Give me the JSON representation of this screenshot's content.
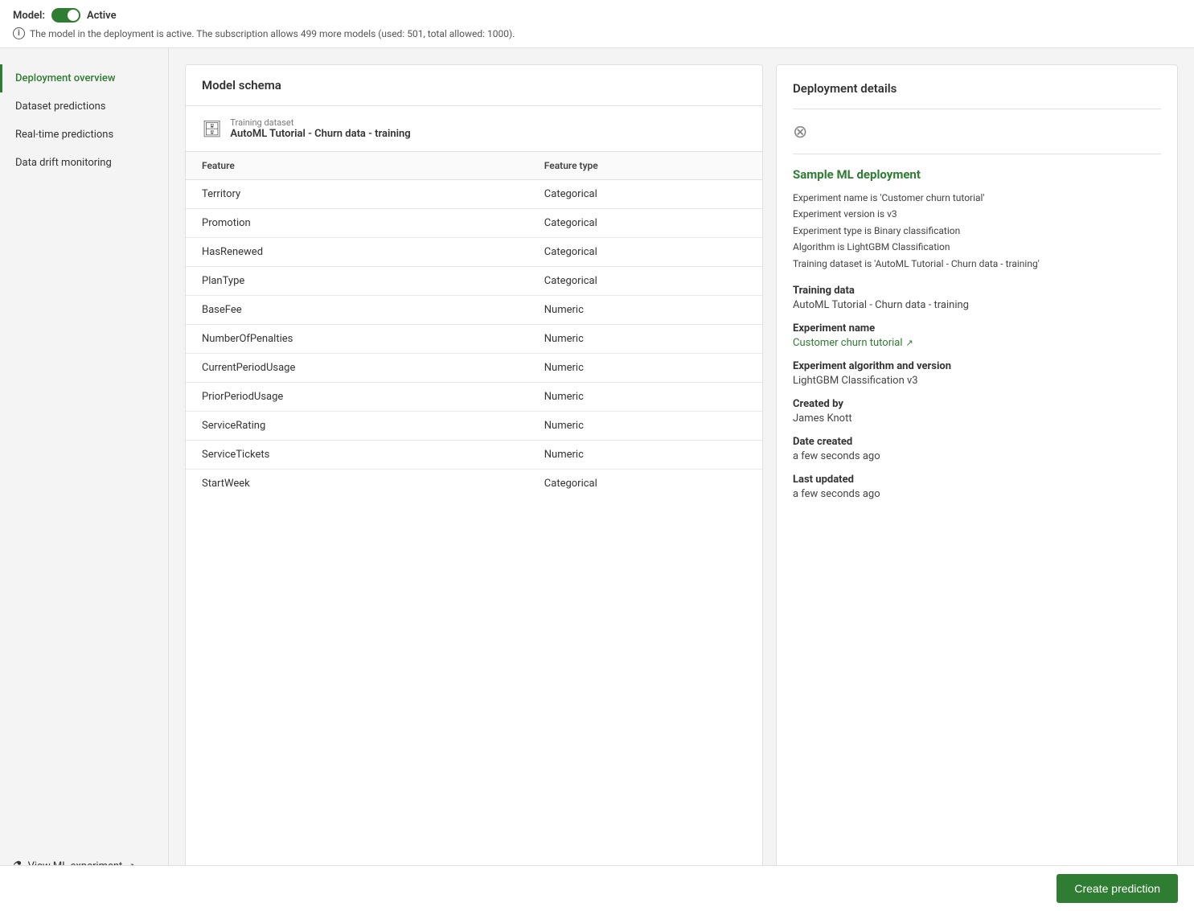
{
  "topBar": {
    "modelLabel": "Model:",
    "modelStatus": "Active",
    "infoMessage": "The model in the deployment is active. The subscription allows 499 more models (used: 501, total allowed: 1000)."
  },
  "sidebar": {
    "navItems": [
      {
        "id": "deployment-overview",
        "label": "Deployment overview",
        "active": true
      },
      {
        "id": "dataset-predictions",
        "label": "Dataset predictions",
        "active": false
      },
      {
        "id": "realtime-predictions",
        "label": "Real-time predictions",
        "active": false
      },
      {
        "id": "data-drift-monitoring",
        "label": "Data drift monitoring",
        "active": false
      }
    ],
    "viewExperiment": "View ML experiment"
  },
  "modelSchema": {
    "title": "Model schema",
    "trainingDatasetLabel": "Training dataset",
    "trainingDatasetName": "AutoML Tutorial - Churn data - training",
    "tableHeaders": [
      "Feature",
      "Feature type"
    ],
    "features": [
      {
        "name": "Territory",
        "type": "Categorical"
      },
      {
        "name": "Promotion",
        "type": "Categorical"
      },
      {
        "name": "HasRenewed",
        "type": "Categorical"
      },
      {
        "name": "PlanType",
        "type": "Categorical"
      },
      {
        "name": "BaseFee",
        "type": "Numeric"
      },
      {
        "name": "NumberOfPenalties",
        "type": "Numeric"
      },
      {
        "name": "CurrentPeriodUsage",
        "type": "Numeric"
      },
      {
        "name": "PriorPeriodUsage",
        "type": "Numeric"
      },
      {
        "name": "ServiceRating",
        "type": "Numeric"
      },
      {
        "name": "ServiceTickets",
        "type": "Numeric"
      },
      {
        "name": "StartWeek",
        "type": "Categorical"
      }
    ]
  },
  "deploymentDetails": {
    "title": "Deployment details",
    "deploymentName": "Sample ML deployment",
    "metaLines": [
      "Experiment name is 'Customer churn tutorial'",
      "Experiment version is v3",
      "Experiment type is Binary classification",
      "Algorithm is LightGBM Classification",
      "Training dataset is 'AutoML Tutorial - Churn data - training'"
    ],
    "sections": [
      {
        "label": "Training data",
        "value": "AutoML Tutorial - Churn data - training",
        "isLink": false
      },
      {
        "label": "Experiment name",
        "value": "Customer churn tutorial",
        "isLink": true
      },
      {
        "label": "Experiment algorithm and version",
        "value": "LightGBM Classification v3",
        "isLink": false
      },
      {
        "label": "Created by",
        "value": "James Knott",
        "isLink": false
      },
      {
        "label": "Date created",
        "value": "a few seconds ago",
        "isLink": false
      },
      {
        "label": "Last updated",
        "value": "a few seconds ago",
        "isLink": false
      }
    ]
  },
  "bottomBar": {
    "createPredictionLabel": "Create prediction"
  }
}
